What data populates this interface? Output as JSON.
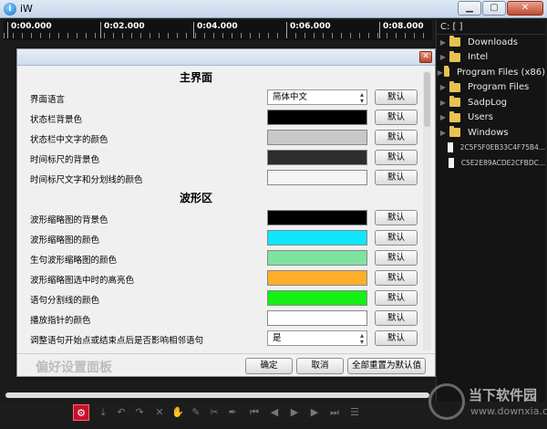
{
  "window": {
    "title": "iW",
    "btn_min": "▁",
    "btn_max": "▢",
    "btn_close": "✕"
  },
  "timeline": {
    "ticks": [
      "0:00.000",
      "0:02.000",
      "0:04.000",
      "0:06.000",
      "0:08.000"
    ]
  },
  "file_panel": {
    "drive": "C:  [  ]",
    "items": [
      {
        "name": "Downloads",
        "type": "folder"
      },
      {
        "name": "Intel",
        "type": "folder"
      },
      {
        "name": "Program Files (x86)",
        "type": "folder"
      },
      {
        "name": "Program Files",
        "type": "folder"
      },
      {
        "name": "SadpLog",
        "type": "folder"
      },
      {
        "name": "Users",
        "type": "folder"
      },
      {
        "name": "Windows",
        "type": "folder"
      },
      {
        "name": "2C5F5F0EB33C4F75B4...",
        "type": "file"
      },
      {
        "name": "C5E2E89ACDE2CFBDC...",
        "type": "file"
      }
    ]
  },
  "dialog": {
    "close": "✕",
    "panel_name": "偏好设置面板",
    "ok": "确定",
    "cancel": "取消",
    "reset_all": "全部重置为默认值",
    "default_label": "默认",
    "sections": {
      "main": "主界面",
      "waveform": "波形区"
    },
    "rows": [
      {
        "label": "界面语言",
        "kind": "select",
        "value": "简体中文"
      },
      {
        "label": "状态栏背景色",
        "kind": "color",
        "color": "#000000"
      },
      {
        "label": "状态栏中文字的颜色",
        "kind": "color",
        "color": "#c8c8c8"
      },
      {
        "label": "时间标尺的背景色",
        "kind": "color",
        "color": "#2d2d2d"
      },
      {
        "label": "时间标尺文字和分划线的颜色",
        "kind": "color",
        "color": "#f4f4f4"
      },
      {
        "label": "波形缩略图的背景色",
        "kind": "color",
        "color": "#000000"
      },
      {
        "label": "波形缩略图的颜色",
        "kind": "color",
        "color": "#11e6ff"
      },
      {
        "label": "生句波形缩略图的颜色",
        "kind": "color",
        "color": "#7fe3a0"
      },
      {
        "label": "波形缩略图选中时的高亮色",
        "kind": "color",
        "color": "#ffae2a"
      },
      {
        "label": "语句分割线的颜色",
        "kind": "color",
        "color": "#14f014"
      },
      {
        "label": "播放指针的颜色",
        "kind": "color",
        "color": "#ffffff"
      },
      {
        "label": "调整语句开始点或结束点后是否影响相邻语句",
        "kind": "select",
        "value": "是"
      }
    ]
  },
  "watermark": {
    "main": "当下软件园",
    "sub": "www.downxia.com"
  },
  "toolbar": {
    "icons": [
      "gear-icon",
      "download-icon",
      "undo-icon",
      "redo-icon",
      "delete-icon",
      "hand-icon",
      "pencil-icon",
      "cut-icon",
      "pen-icon",
      "first-icon",
      "prev-icon",
      "play-icon",
      "next-icon",
      "last-icon",
      "list-icon"
    ]
  }
}
